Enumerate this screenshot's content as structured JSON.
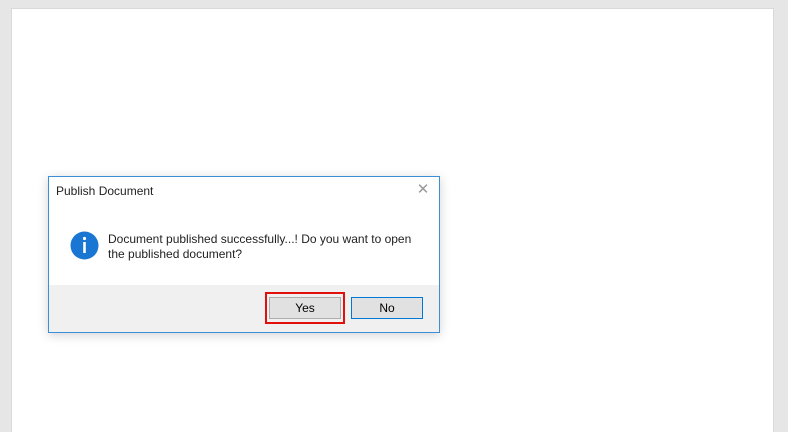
{
  "dialog": {
    "title": "Publish Document",
    "close_symbol": "✕",
    "icon": "info-icon",
    "message": "Document published successfully...! Do you want to open the published document?",
    "buttons": {
      "yes": "Yes",
      "no": "No"
    }
  },
  "colors": {
    "dialog_border": "#3c8fd6",
    "info_icon": "#1976d2",
    "highlight": "#e30e0e",
    "default_button_border": "#0078d7"
  }
}
